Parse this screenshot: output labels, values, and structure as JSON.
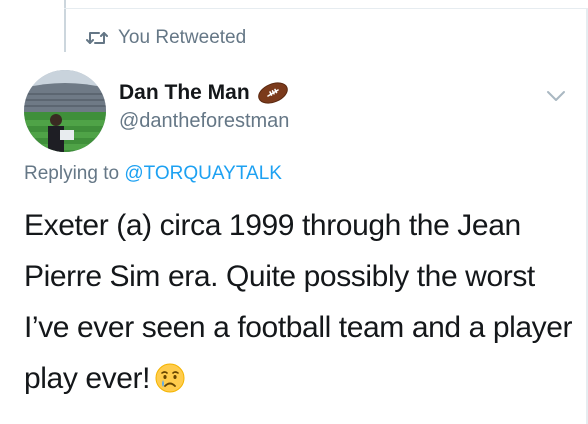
{
  "retweet": {
    "icon": "retweet-icon",
    "label": "You Retweeted"
  },
  "author": {
    "display_name": "Dan The Man",
    "name_emoji": "american-football-icon",
    "handle": "@dantheforestman",
    "avatar": "avatar-football-stadium"
  },
  "menu": {
    "icon": "chevron-down-icon"
  },
  "reply": {
    "prefix": "Replying to",
    "mention": "@TORQUAYTALK"
  },
  "tweet": {
    "text": "Exeter (a) circa 1999 through the Jean Pierre Sim era. Quite possibly the worst I’ve ever seen a football team and a player play ever!",
    "emoji": "crying-face-icon"
  },
  "colors": {
    "link": "#1da1f2",
    "secondary_text": "#657786",
    "primary_text": "#14171a"
  }
}
